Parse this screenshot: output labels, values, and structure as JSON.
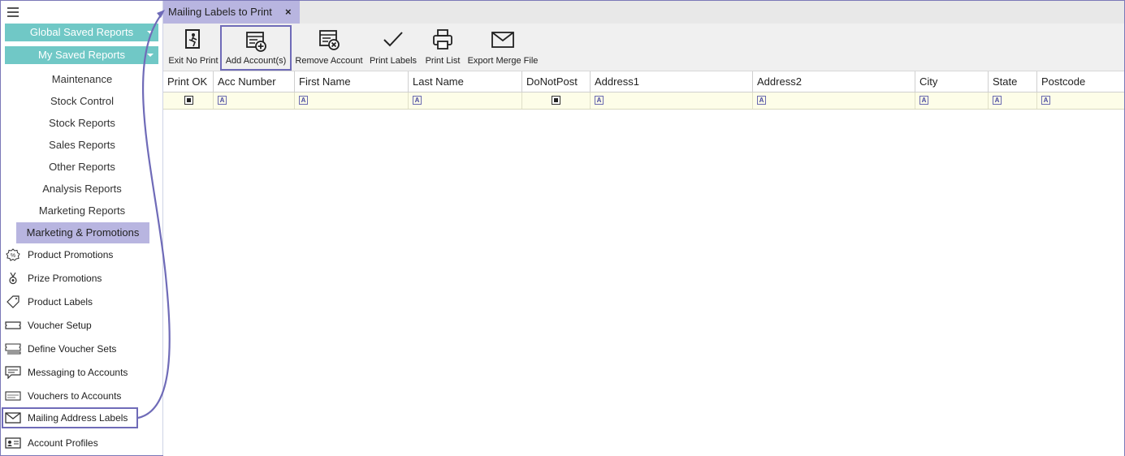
{
  "sidebar": {
    "global_saved_reports": "Global Saved Reports",
    "my_saved_reports": "My Saved Reports",
    "menu": [
      "Maintenance",
      "Stock Control",
      "Stock Reports",
      "Sales Reports",
      "Other Reports",
      "Analysis Reports",
      "Marketing Reports"
    ],
    "active_menu": "Marketing & Promotions",
    "items": [
      {
        "label": "Product Promotions",
        "icon": "percent-badge-icon"
      },
      {
        "label": "Prize Promotions",
        "icon": "medal-icon"
      },
      {
        "label": "Product Labels",
        "icon": "tag-icon"
      },
      {
        "label": "Voucher Setup",
        "icon": "ticket-icon"
      },
      {
        "label": "Define Voucher Sets",
        "icon": "ticket-stack-icon"
      },
      {
        "label": "Messaging to Accounts",
        "icon": "message-icon"
      },
      {
        "label": "Vouchers to Accounts",
        "icon": "voucher-send-icon"
      },
      {
        "label": "Mailing Address Labels",
        "icon": "envelope-icon"
      },
      {
        "label": "Account Profiles",
        "icon": "id-card-icon"
      }
    ]
  },
  "tab": {
    "label": "Mailing Labels to Print",
    "close": "×"
  },
  "toolbar": {
    "exit_no_print": "Exit No Print",
    "add_accounts": "Add Account(s)",
    "remove_account": "Remove Account",
    "print_labels": "Print Labels",
    "print_list": "Print List",
    "export_merge_file": "Export Merge File"
  },
  "grid": {
    "columns": [
      "Print OK",
      "Acc Number",
      "First Name",
      "Last Name",
      "DoNotPost",
      "Address1",
      "Address2",
      "City",
      "State",
      "Postcode"
    ],
    "filter_text_marker": "A"
  },
  "colors": {
    "accent": "#70c8c6",
    "highlight": "#b8b5e0",
    "annotation": "#6f6bb8"
  }
}
